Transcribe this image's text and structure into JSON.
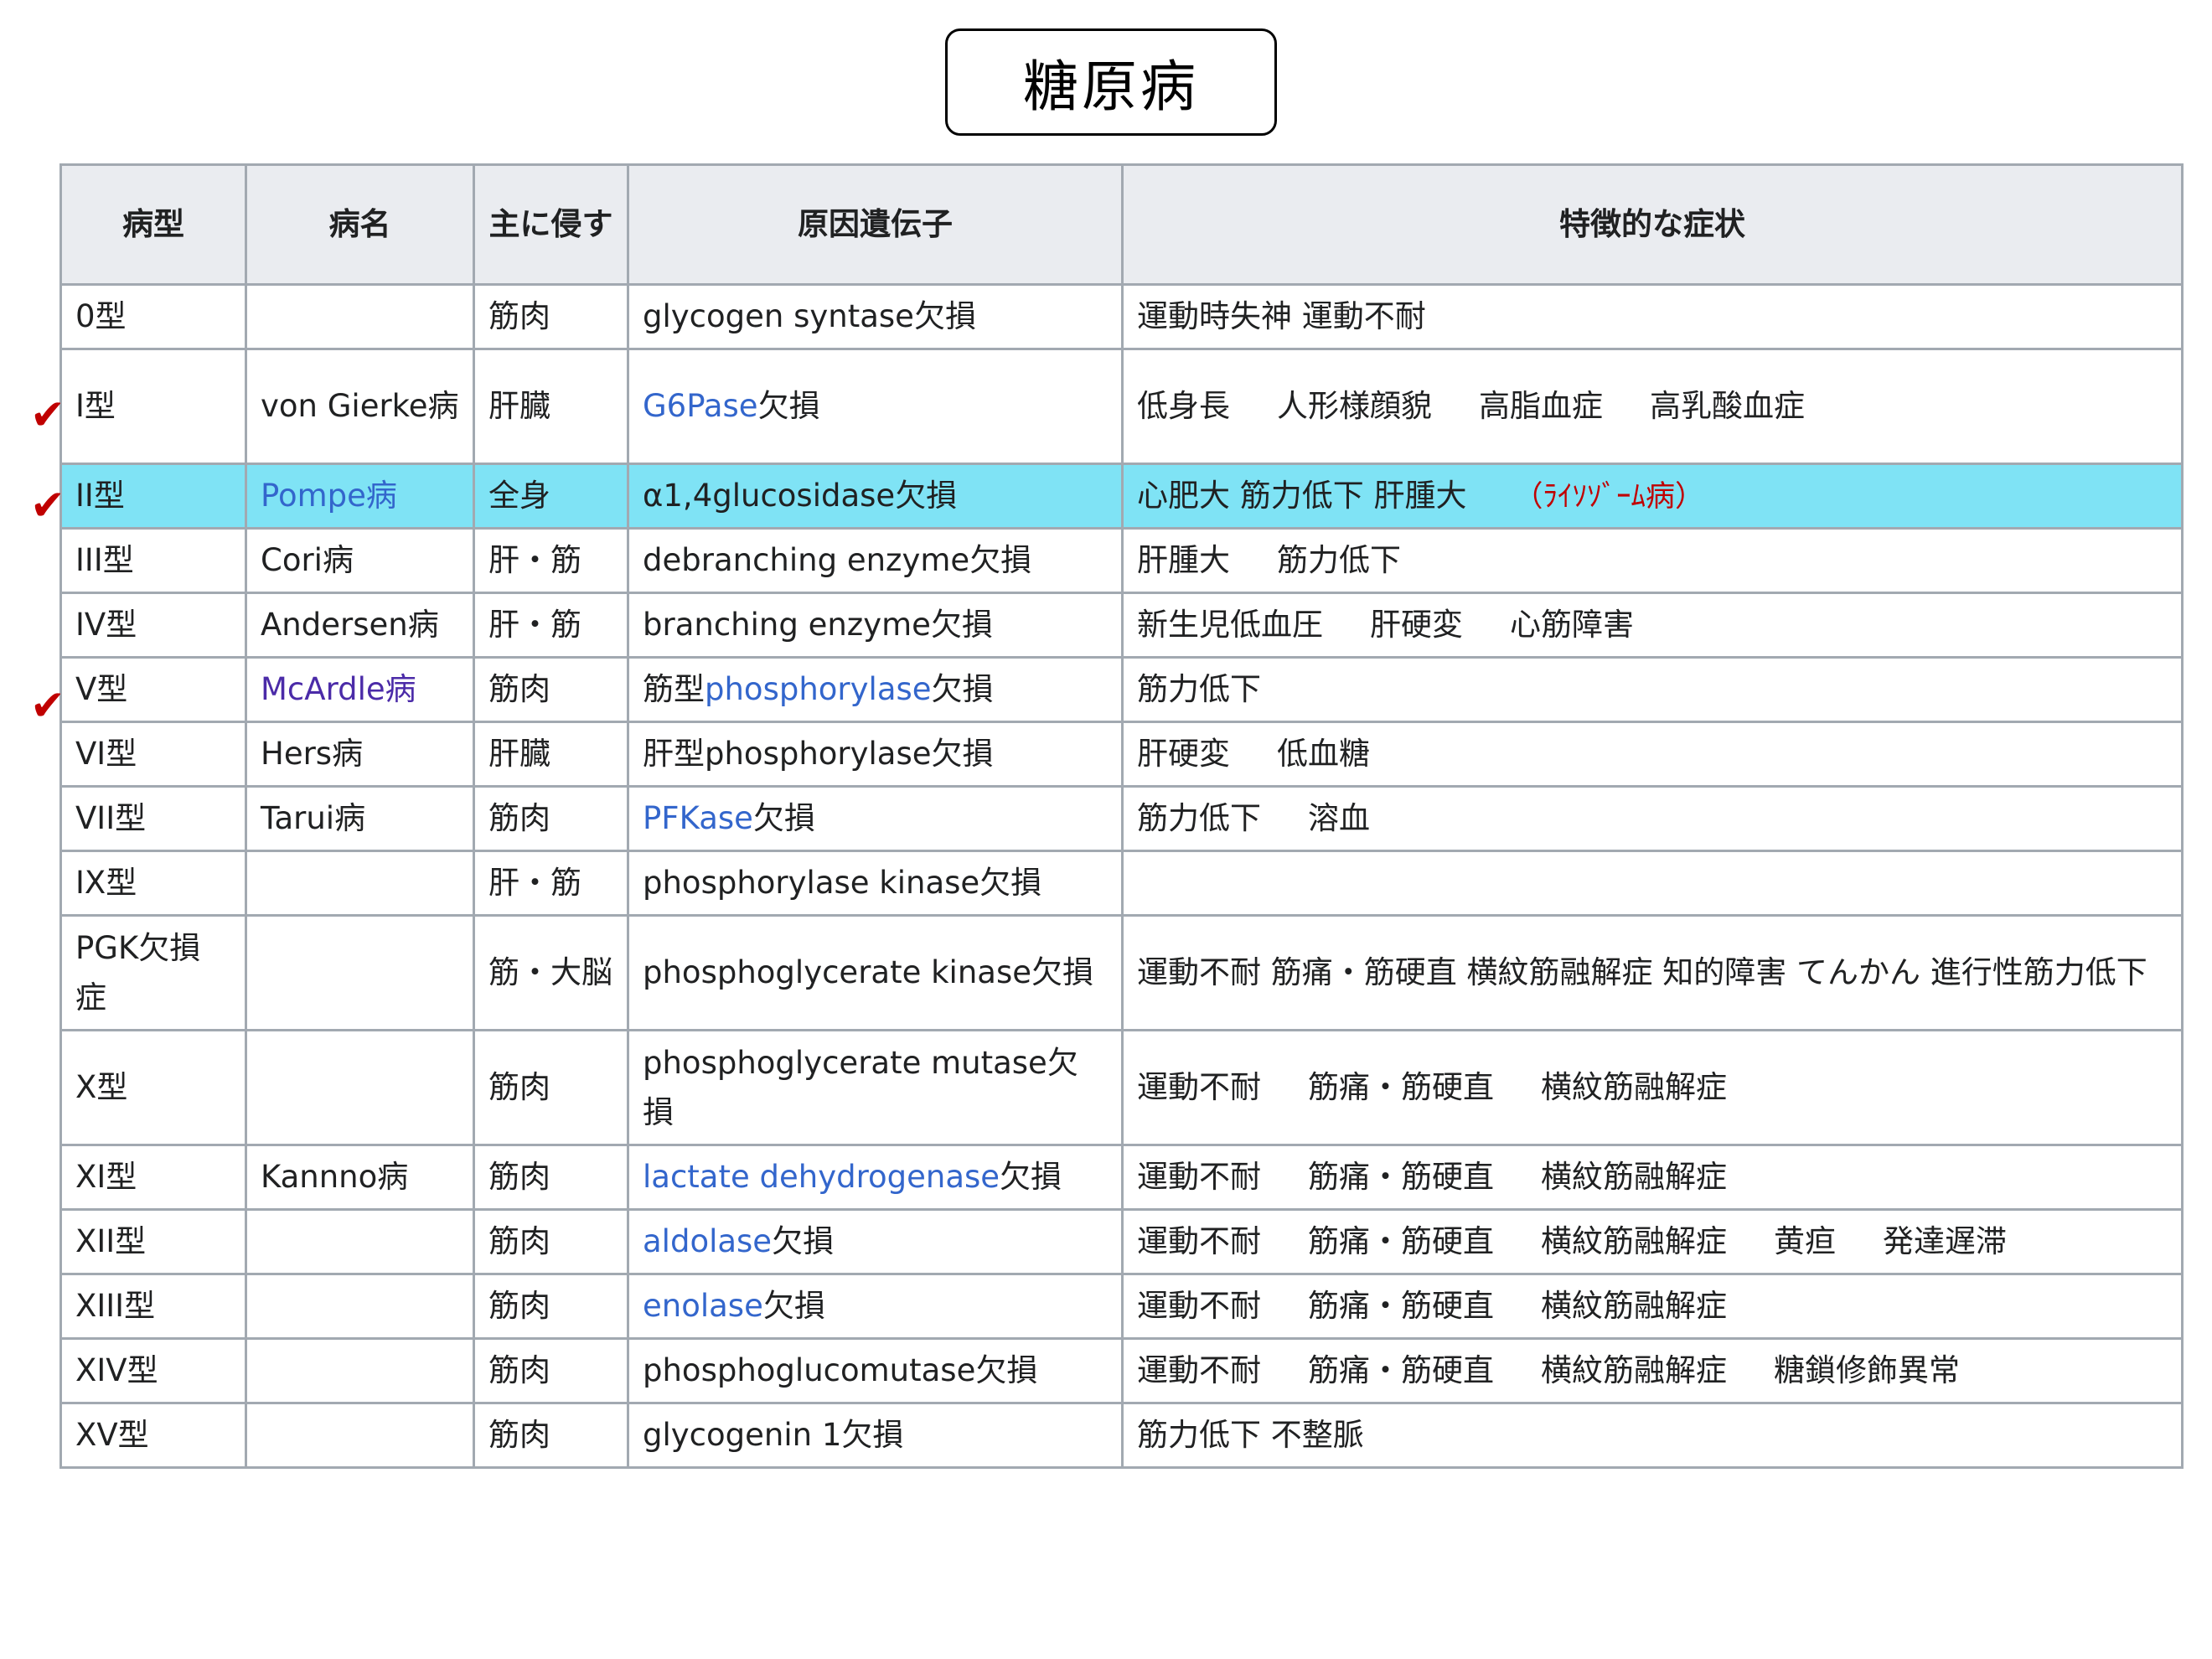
{
  "title": "糖原病",
  "headers": [
    "病型",
    "病名",
    "主に侵す",
    "原因遺伝子",
    "特徴的な症状"
  ],
  "check_mark": "✔",
  "rows": [
    {
      "type": "0型",
      "name": "",
      "organ": "筋肉",
      "gene": "glycogen syntase",
      "gene_link": "",
      "suffix": "欠損",
      "symptoms": [
        "運動時失神 運動不耐"
      ]
    },
    {
      "type": "I型",
      "name": "von Gierke病",
      "organ": "肝臓",
      "gene": "",
      "gene_link": "G6Pase",
      "suffix": "欠損",
      "symptoms": [
        "低身長",
        "人形様顔貌",
        "高脂血症",
        "高乳酸血症"
      ]
    },
    {
      "type": "II型",
      "name": "Pompe病",
      "organ": "全身",
      "gene": "α1,4glucosidase",
      "gene_link": "",
      "suffix": "欠損",
      "symptoms": [
        "心肥大 筋力低下 肝腫大"
      ],
      "note": "（ﾗｲｿｿﾞｰﾑ病）"
    },
    {
      "type": "III型",
      "name": "Cori病",
      "organ": "肝・筋",
      "gene": "debranching enzyme",
      "gene_link": "",
      "suffix": "欠損",
      "symptoms": [
        "肝腫大",
        "筋力低下"
      ]
    },
    {
      "type": "IV型",
      "name": "Andersen病",
      "organ": "肝・筋",
      "gene": "branching enzyme",
      "gene_link": "",
      "suffix": "欠損",
      "symptoms": [
        "新生児低血圧",
        "肝硬変",
        "心筋障害"
      ]
    },
    {
      "type": "V型",
      "name": "McArdle病",
      "organ": "筋肉",
      "gene": "筋型",
      "gene_link": "phosphorylase",
      "suffix": "欠損",
      "symptoms": [
        "筋力低下"
      ]
    },
    {
      "type": "VI型",
      "name": "Hers病",
      "organ": "肝臓",
      "gene": "肝型phosphorylase",
      "gene_link": "",
      "suffix": "欠損",
      "symptoms": [
        "肝硬変",
        "低血糖"
      ]
    },
    {
      "type": "VII型",
      "name": "Tarui病",
      "organ": "筋肉",
      "gene": "",
      "gene_link": "PFKase",
      "suffix": "欠損",
      "symptoms": [
        "筋力低下",
        "溶血"
      ]
    },
    {
      "type": "IX型",
      "name": "",
      "organ": "肝・筋",
      "gene": "phosphorylase kinase",
      "gene_link": "",
      "suffix": "欠損",
      "symptoms": []
    },
    {
      "type": "PGK欠損症",
      "name": "",
      "organ": "筋・大脳",
      "gene": "phosphoglycerate kinase",
      "gene_link": "",
      "suffix": "欠損",
      "symptoms": [
        "運動不耐 筋痛・筋硬直 横紋筋融解症 知的障害 てんかん 進行性筋力低下"
      ]
    },
    {
      "type": "X型",
      "name": "",
      "organ": "筋肉",
      "gene": "phosphoglycerate mutase",
      "gene_link": "",
      "suffix": "欠損",
      "symptoms": [
        "運動不耐",
        "筋痛・筋硬直",
        "横紋筋融解症"
      ]
    },
    {
      "type": "XI型",
      "name": "Kannno病",
      "organ": "筋肉",
      "gene": "",
      "gene_link": "lactate dehydrogenase",
      "suffix": "欠損",
      "symptoms": [
        "運動不耐",
        "筋痛・筋硬直",
        "横紋筋融解症"
      ]
    },
    {
      "type": "XII型",
      "name": "",
      "organ": "筋肉",
      "gene": "",
      "gene_link": "aldolase",
      "suffix": "欠損",
      "symptoms": [
        "運動不耐",
        "筋痛・筋硬直",
        "横紋筋融解症",
        "黄疸",
        "発達遅滞"
      ]
    },
    {
      "type": "XIII型",
      "name": "",
      "organ": "筋肉",
      "gene": "",
      "gene_link": "enolase",
      "suffix": "欠損",
      "symptoms": [
        "運動不耐",
        "筋痛・筋硬直",
        "横紋筋融解症"
      ]
    },
    {
      "type": "XIV型",
      "name": "",
      "organ": "筋肉",
      "gene": "phosphoglucomutase",
      "gene_link": "",
      "suffix": "欠損",
      "symptoms": [
        "運動不耐",
        "筋痛・筋硬直",
        "横紋筋融解症",
        "糖鎖修飾異常"
      ]
    },
    {
      "type": "XV型",
      "name": "",
      "organ": "筋肉",
      "gene": "glycogenin 1",
      "gene_link": "",
      "suffix": "欠損",
      "symptoms": [
        "筋力低下 不整脈"
      ]
    }
  ]
}
